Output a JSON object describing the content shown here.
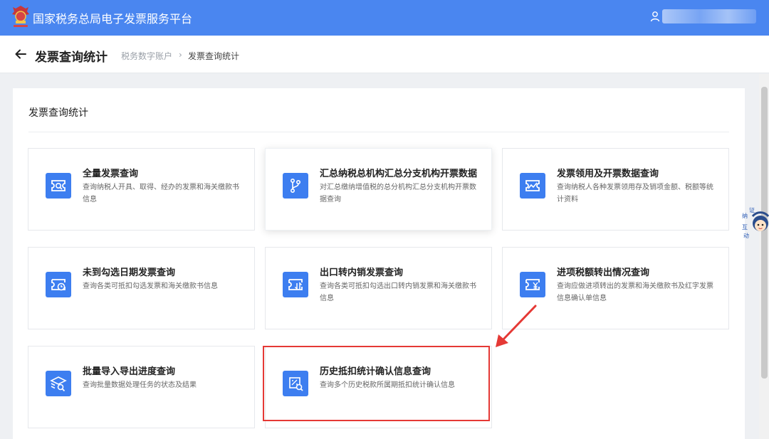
{
  "header": {
    "title": "国家税务总局电子发票服务平台",
    "user_icon": "user-icon"
  },
  "subheader": {
    "back_icon": "arrow-left-icon",
    "page_title": "发票查询统计",
    "breadcrumb": [
      "税务数字账户",
      "发票查询统计"
    ]
  },
  "section": {
    "title": "发票查询统计"
  },
  "cards": [
    {
      "title": "全量发票查询",
      "desc": "查询纳税人开具、取得、经办的发票和海关缴款书信息",
      "icon": "invoice-search-icon"
    },
    {
      "title": "汇总纳税总机构汇总分支机构开票数据",
      "desc": "对汇总缴纳增值税的总分机构汇总分支机构开票数据查询",
      "icon": "branch-icon"
    },
    {
      "title": "发票领用及开票数据查询",
      "desc": "查询纳税人各种发票领用存及销项金额、税额等统计资料",
      "icon": "trend-chart-icon"
    },
    {
      "title": "未到勾选日期发票查询",
      "desc": "查询各类可抵扣勾选发票和海关缴款书信息",
      "icon": "invoice-clock-icon"
    },
    {
      "title": "出口转内销发票查询",
      "desc": "查询各类可抵扣勾选出口转内销发票和海关缴款书信息",
      "icon": "invoice-transfer-icon"
    },
    {
      "title": "进项税额转出情况查询",
      "desc": "查询应做进项转出的发票和海关缴款书及红字发票信息确认单信息",
      "icon": "yuan-invoice-icon"
    },
    {
      "title": "批量导入导出进度查询",
      "desc": "查询批量数据处理任务的状态及结果",
      "icon": "batch-search-icon"
    },
    {
      "title": "历史抵扣统计确认信息查询",
      "desc": "查询多个历史税款所属期抵扣统计确认信息",
      "icon": "stats-search-icon"
    }
  ],
  "colors": {
    "header_bg": "#4a86f0",
    "icon_bg": "#3d7ef0",
    "highlight": "#e53935"
  },
  "mascot": {
    "chars": [
      "纳",
      "证",
      "互",
      "动"
    ]
  }
}
